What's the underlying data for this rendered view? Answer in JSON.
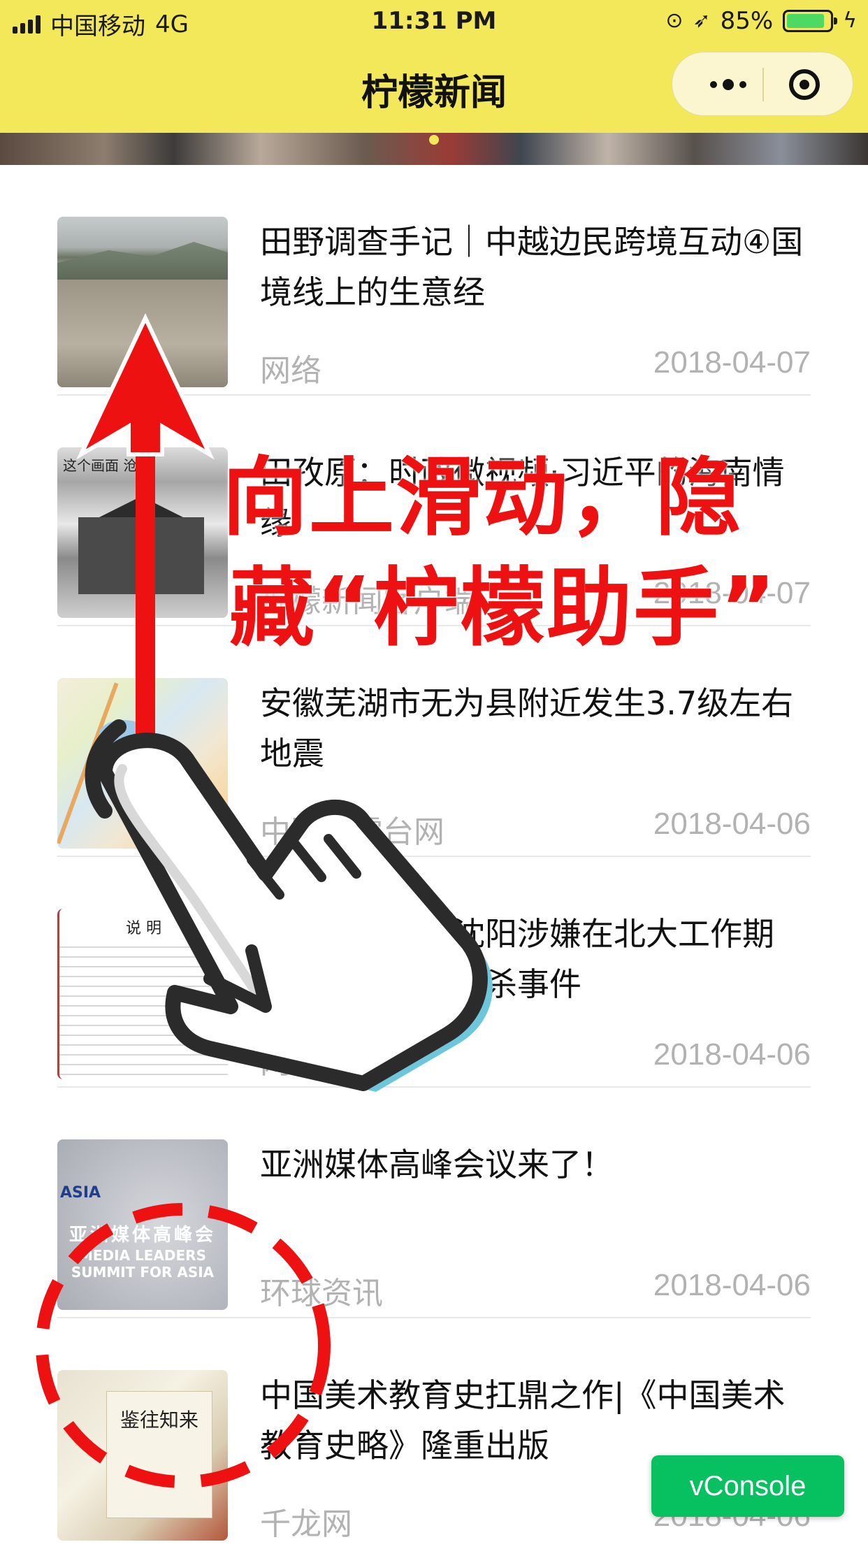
{
  "status_bar": {
    "carrier": "中国移动",
    "network": "4G",
    "time": "11:31 PM",
    "battery_pct": "85%",
    "battery_level": 0.85,
    "icons": [
      "signal-icon",
      "orientation-lock-icon",
      "location-icon",
      "battery-icon",
      "charging-icon"
    ]
  },
  "navbar": {
    "title": "柠檬新闻",
    "capsule_icons": [
      "more-dots-icon",
      "close-target-icon"
    ]
  },
  "news": [
    {
      "title": "田野调查手记｜中越边民跨境互动④国境线上的生意经",
      "source": "网络",
      "date": "2018-04-07"
    },
    {
      "title": "田孜原：时政微视频·习近平的海南情缘",
      "source": "柠檬新闻客户端",
      "date": "2018-04-07"
    },
    {
      "title": "安徽芜湖市无为县附近发生3.7级左右地震",
      "source": "中国地震台网",
      "date": "2018-04-06"
    },
    {
      "title": "南京大学回应沈阳涉嫌在北大工作期间性侵致女生自杀事件",
      "source": "网络",
      "date": "2018-04-06"
    },
    {
      "title": "亚洲媒体高峰会议来了！",
      "source": "环球资讯",
      "date": "2018-04-06"
    },
    {
      "title": "中国美术教育史扛鼎之作|《中国美术教育史略》隆重出版",
      "source": "千龙网",
      "date": "2018-04-06"
    }
  ],
  "thumb_text": {
    "t2_caption": "这个画面 沧桑",
    "t4_heading": "说 明",
    "t5_logo": "ASIA",
    "t5_band1": "亚洲媒体高峰会",
    "t5_band2": "MEDIA LEADERS SUMMIT FOR ASIA",
    "t6_book": "鉴往知来"
  },
  "overlay": {
    "line1": "向上滑动，隐",
    "line2": "藏“柠檬助手”",
    "arrow_color": "#ee1111",
    "circle_color": "#ee1111"
  },
  "vconsole": {
    "label": "vConsole",
    "color": "#07c160"
  },
  "colors": {
    "header_bg": "#f2e85a",
    "meta_gray": "#b2b2b2"
  }
}
